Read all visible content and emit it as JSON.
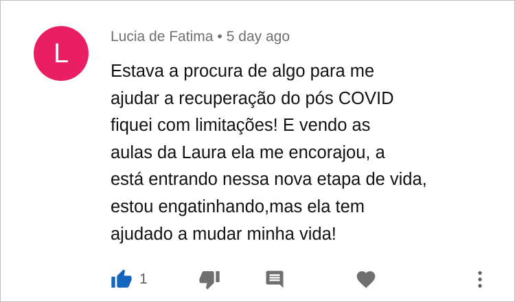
{
  "comment": {
    "avatar_letter": "L",
    "author": "Lucia de Fatima",
    "separator": "•",
    "time": "5 day ago",
    "text": "Estava a procura de algo para me\najudar a recuperação do pós COVID\nfiquei com limitações! E vendo as\naulas da Laura ela me encorajou, a\nestá entrando nessa nova etapa de vida,\nestou engatinhando,mas ela tem\najudado a mudar minha vida!"
  },
  "actions": {
    "like_count": "1",
    "like_icon": "thumbs-up-icon",
    "dislike_icon": "thumbs-down-icon",
    "reply_icon": "comment-icon",
    "heart_icon": "heart-icon",
    "more_icon": "more-vertical-icon"
  },
  "colors": {
    "avatar_bg": "#e91e63",
    "like_active": "#1565c0",
    "icon_gray": "#6f6f6f"
  }
}
